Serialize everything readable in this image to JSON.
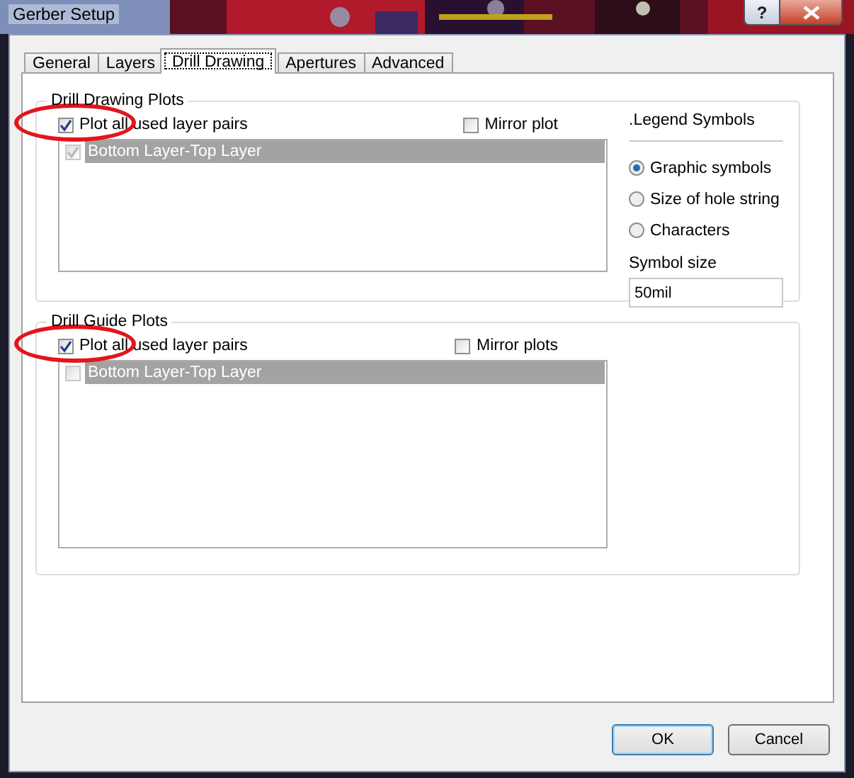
{
  "window": {
    "title": "Gerber Setup",
    "help": "?"
  },
  "tabs": [
    {
      "label": "General",
      "selected": false
    },
    {
      "label": "Layers",
      "selected": false
    },
    {
      "label": "Drill Drawing",
      "selected": true
    },
    {
      "label": "Apertures",
      "selected": false
    },
    {
      "label": "Advanced",
      "selected": false
    }
  ],
  "drill_drawing_plots": {
    "title": "Drill Drawing Plots",
    "plot_all": {
      "label": "Plot all used layer pairs",
      "checked": true,
      "circled": true
    },
    "mirror": {
      "label": "Mirror plot",
      "checked": false
    },
    "layer_pairs": [
      {
        "label": "Bottom Layer-Top Layer",
        "checked": true,
        "selected": true
      }
    ]
  },
  "legend_symbols": {
    "title": ".Legend Symbols",
    "options": [
      {
        "label": "Graphic symbols",
        "selected": true
      },
      {
        "label": "Size of hole string",
        "selected": false
      },
      {
        "label": "Characters",
        "selected": false
      }
    ],
    "symbol_size": {
      "label": "Symbol size",
      "value": "50mil"
    }
  },
  "drill_guide_plots": {
    "title": "Drill Guide Plots",
    "plot_all": {
      "label": "Plot all used layer pairs",
      "checked": true,
      "circled": true
    },
    "mirror": {
      "label": "Mirror plots",
      "checked": false
    },
    "layer_pairs": [
      {
        "label": "Bottom Layer-Top Layer",
        "checked": false,
        "selected": true
      }
    ]
  },
  "buttons": [
    {
      "label": "OK",
      "default": true
    },
    {
      "label": "Cancel",
      "default": false
    }
  ]
}
